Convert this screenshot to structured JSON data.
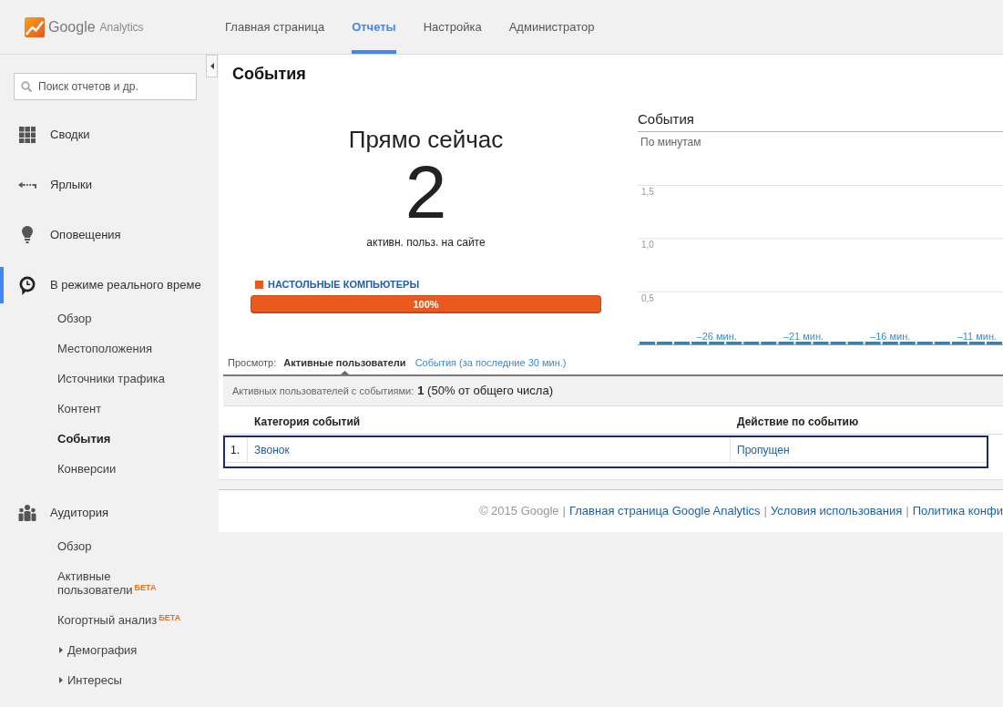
{
  "header": {
    "logo": {
      "brand": "Google",
      "product": "Analytics"
    },
    "tabs": [
      {
        "label": "Главная страница",
        "selected": false
      },
      {
        "label": "Отчеты",
        "selected": true
      },
      {
        "label": "Настройка",
        "selected": false
      },
      {
        "label": "Администратор",
        "selected": false
      }
    ]
  },
  "sidebar": {
    "search": {
      "placeholder": "Поиск отчетов и др."
    },
    "sections": [
      {
        "label": "Сводки",
        "selected": false
      },
      {
        "label": "Ярлыки",
        "selected": false
      },
      {
        "label": "Оповещения",
        "selected": false
      },
      {
        "label": "В режиме реального време",
        "selected": true,
        "children": [
          {
            "label": "Обзор",
            "selected": false
          },
          {
            "label": "Местоположения",
            "selected": false
          },
          {
            "label": "Источники трафика",
            "selected": false
          },
          {
            "label": "Контент",
            "selected": false
          },
          {
            "label": "События",
            "selected": true
          },
          {
            "label": "Конверсии",
            "selected": false
          }
        ]
      },
      {
        "label": "Аудитория",
        "selected": false,
        "children": [
          {
            "label": "Обзор",
            "selected": false
          },
          {
            "label": "Активные пользователи",
            "badge": "БЕТА",
            "selected": false
          },
          {
            "label": "Когортный анализ",
            "badge": "БЕТА",
            "selected": false
          },
          {
            "label": "Демография",
            "expanded": false,
            "selected": false
          },
          {
            "label": "Интересы",
            "expanded": false,
            "selected": false
          }
        ]
      }
    ]
  },
  "report": {
    "title": "События",
    "realtime": {
      "heading": "Прямо сейчас",
      "count": "2",
      "caption": "активн. польз. на сайте",
      "devices": [
        {
          "label": "НАСТОЛЬНЫЕ КОМПЬЮТЕРЫ",
          "color": "#ea5a1e",
          "level": 1,
          "reading": "100%"
        }
      ]
    },
    "chart": {
      "subtitle": "По минутам",
      "chart_data": {
        "type": "bar",
        "title": "События",
        "x": [
          -30,
          -29,
          -28,
          -27,
          -26,
          -25,
          -24,
          -23,
          -22,
          -21,
          -20,
          -19,
          -18,
          -17,
          -16,
          -15,
          -14,
          -13,
          -12,
          -11,
          -10
        ],
        "series": [
          {
            "color": "#1a8bcd",
            "values": [
              0,
              0,
              0,
              0,
              0,
              0,
              0,
              0,
              0,
              0,
              0,
              0,
              0,
              0,
              0,
              0,
              0,
              0,
              0,
              0,
              0
            ]
          }
        ],
        "xlim": [
          -30.55,
          -9.5
        ],
        "ylim": [
          0,
          1.5
        ],
        "grid": true,
        "xticks": [
          {
            "value": -26,
            "label": "–26 мин."
          },
          {
            "value": -21,
            "label": "–21 мин."
          },
          {
            "value": -16,
            "label": "–16 мин."
          },
          {
            "value": -11,
            "label": "–11 мин."
          }
        ],
        "yticks": [
          {
            "value": 0.5,
            "label": "0,5"
          },
          {
            "value": 1,
            "label": "1,0"
          },
          {
            "value": 1.5,
            "label": "1,5"
          }
        ]
      }
    },
    "view": {
      "label": "Просмотр:",
      "tabs": [
        {
          "label": "Активные пользователи",
          "selected": true
        },
        {
          "label": "События (за последние 30 мин.)",
          "selected": false
        }
      ]
    },
    "summary": {
      "label": "Активных пользователей с событиями:",
      "value": "**1** (50% от общего числа)"
    },
    "table": {
      "columns": [
        "Категория событий",
        "Действие по событию"
      ],
      "rows": [
        {
          "number": "1.",
          "cells": [
            "Звонок",
            "Пропущен"
          ],
          "selected": true
        }
      ]
    }
  },
  "footer": {
    "copyright": "© 2015 Google",
    "separator": "|",
    "links": [
      "Главная страница Google Analytics",
      "Условия использования",
      "Политика конфи"
    ]
  }
}
